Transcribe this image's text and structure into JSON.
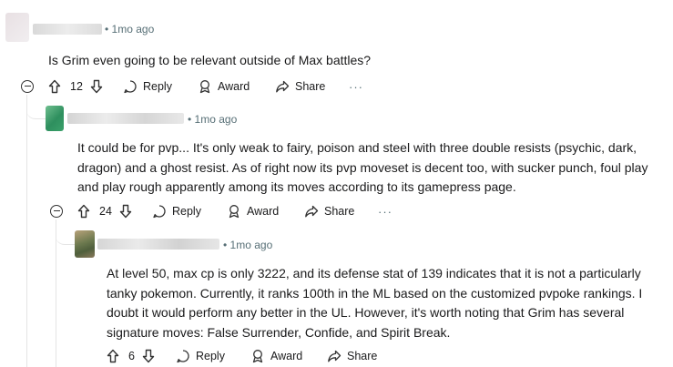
{
  "comments": [
    {
      "time": "1mo ago",
      "body": "Is Grim even going to be relevant outside of Max battles?",
      "votes": "12"
    },
    {
      "time": "1mo ago",
      "body": "It could be for pvp... It's only weak to fairy, poison and steel with three double resists (psychic, dark, dragon) and a ghost resist. As of right now its pvp moveset is decent too, with sucker punch, foul play and play rough apparently among its moves according to its gamepress page.",
      "votes": "24"
    },
    {
      "time": "1mo ago",
      "body": "At level 50, max cp is only 3222, and its defense stat of 139 indicates that it is not a particularly tanky pokemon. Currently, it ranks 100th in the ML based on the customized pvpoke rankings. I doubt it would perform any better in the UL. However, it's worth noting that Grim has several signature moves: False Surrender, Confide, and Spirit Break.",
      "votes": "6"
    }
  ],
  "actions": {
    "reply": "Reply",
    "award": "Award",
    "share": "Share",
    "more": "···"
  },
  "colors": {
    "meta": "#576f76",
    "thread_line": "#e5e5e5",
    "avatar_comment_2": "#2e8f5e"
  },
  "icons": [
    "collapse-icon",
    "upvote-icon",
    "downvote-icon",
    "reply-icon",
    "award-icon",
    "share-icon",
    "more-icon"
  ]
}
